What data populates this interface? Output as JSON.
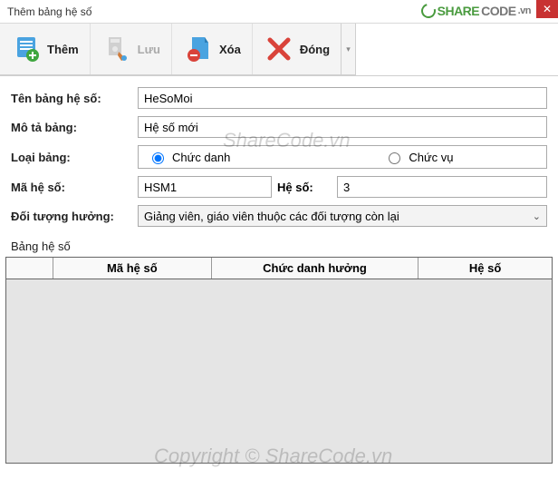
{
  "window": {
    "title": "Thêm bảng hệ số"
  },
  "logo": {
    "share": "SHARE",
    "code": "CODE",
    "suffix": ".vn"
  },
  "toolbar": {
    "them": "Thêm",
    "luu": "Lưu",
    "xoa": "Xóa",
    "dong": "Đóng"
  },
  "labels": {
    "ten_bang": "Tên bảng hệ số:",
    "mo_ta": "Mô tả bảng:",
    "loai_bang": "Loại bảng:",
    "ma_he_so": "Mã hệ số:",
    "he_so": "Hệ số:",
    "doi_tuong": "Đối tượng hưởng:",
    "section": "Bảng hệ số"
  },
  "values": {
    "ten_bang": "HeSoMoi",
    "mo_ta": "Hệ số mới",
    "ma_he_so": "HSM1",
    "he_so": "3",
    "doi_tuong": "Giảng viên, giáo viên thuộc các đối tượng còn lại"
  },
  "radios": {
    "chuc_danh": "Chức danh",
    "chuc_vu": "Chức vụ"
  },
  "grid": {
    "headers": {
      "ma": "Mã hệ số",
      "chuc": "Chức danh hưởng",
      "hs": "Hệ số"
    }
  },
  "watermarks": {
    "center": "ShareCode.vn",
    "bottom": "Copyright © ShareCode.vn"
  }
}
